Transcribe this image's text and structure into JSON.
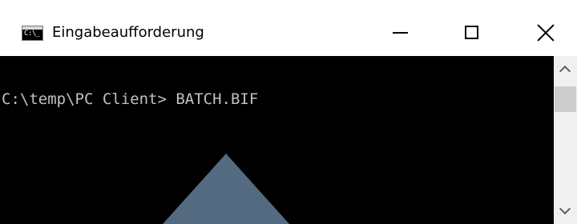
{
  "window": {
    "title": "Eingabeaufforderung",
    "icon": {
      "name": "command-prompt-icon",
      "glyph_text": "C:\\_"
    },
    "controls": {
      "minimize_icon": "minimize-icon",
      "maximize_icon": "maximize-icon",
      "close_icon": "close-icon"
    }
  },
  "console": {
    "lines": [
      "C:\\temp\\PC Client> BATCH.BIF"
    ],
    "background_color": "#000000",
    "text_color": "#c0c0c0",
    "pointer_color": "#536a80"
  },
  "scrollbar": {
    "up_icon": "chevron-up-icon",
    "down_icon": "chevron-down-icon"
  }
}
